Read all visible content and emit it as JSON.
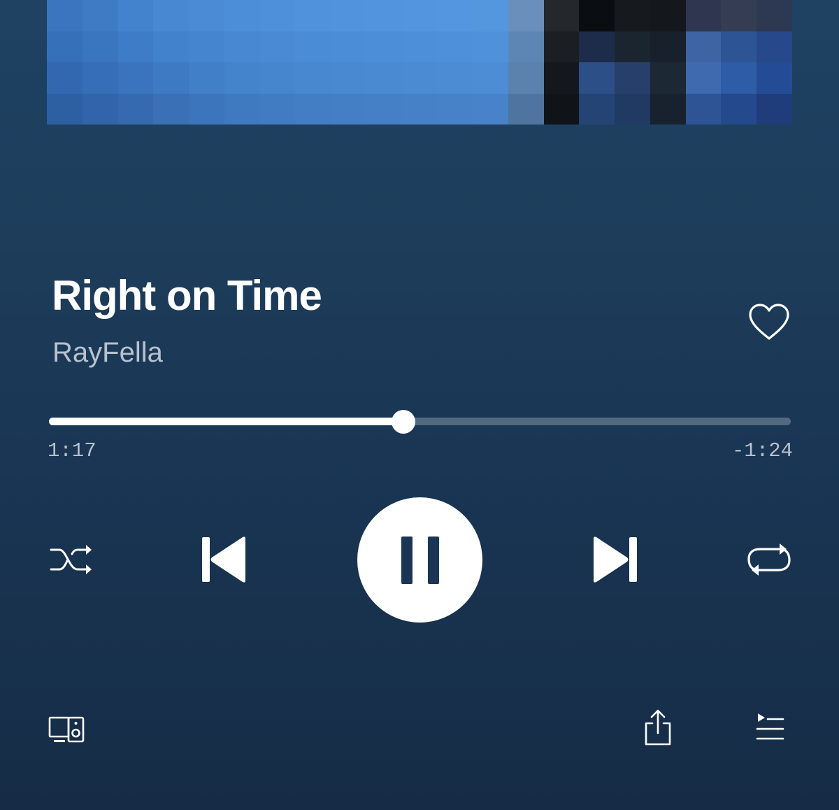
{
  "track": {
    "title": "Right on Time",
    "artist": "RayFella",
    "liked": false
  },
  "playback": {
    "elapsed": "1:17",
    "remaining": "-1:24",
    "progress_fraction": 0.478,
    "state": "playing"
  },
  "icons": {
    "like": "heart-outline-icon",
    "shuffle": "shuffle-icon",
    "previous": "skip-previous-icon",
    "pause": "pause-icon",
    "next": "skip-next-icon",
    "repeat": "repeat-icon",
    "devices": "connect-devices-icon",
    "share": "share-icon",
    "queue": "queue-icon"
  },
  "colors": {
    "background_top": "#1f4263",
    "background_bottom": "#162c46",
    "text_primary": "#ffffff",
    "text_secondary": "#b7c2cd",
    "progress_remaining": "rgba(255,255,255,0.25)"
  },
  "album_art": {
    "pixels": [
      [
        "#3b75bf",
        "#3f7bc5",
        "#4382cc",
        "#4888d2",
        "#4b8bd5",
        "#4d8ed8",
        "#4f90da",
        "#5092db",
        "#5193dc",
        "#5294dd",
        "#5395de",
        "#5496df",
        "#5597df",
        "#6a8fba",
        "#24272b",
        "#0a0d12",
        "#16191d",
        "#14181c",
        "#2f3650",
        "#353d55",
        "#2d3952"
      ],
      [
        "#3670b9",
        "#3a76c0",
        "#3e7cc7",
        "#4282cd",
        "#4585d0",
        "#4888d3",
        "#4a8ad5",
        "#4b8cd6",
        "#4c8dd7",
        "#4d8ed8",
        "#4e8fd9",
        "#4f90da",
        "#5091db",
        "#5e86b4",
        "#1b1f24",
        "#1d2c4a",
        "#1a2530",
        "#18212b",
        "#3e64a3",
        "#2d5596",
        "#27488a"
      ],
      [
        "#3268b0",
        "#366eb7",
        "#3a74be",
        "#3e7ac4",
        "#4180c9",
        "#4484cc",
        "#4686ce",
        "#4888d0",
        "#4989d1",
        "#4a8ad2",
        "#4b8bd3",
        "#4c8cd4",
        "#4d8dd5",
        "#5a82ad",
        "#14171b",
        "#2c4f87",
        "#263f6b",
        "#1c2833",
        "#3f6ab0",
        "#2f5ca6",
        "#244c96"
      ],
      [
        "#2d5fa3",
        "#3164aa",
        "#356ab0",
        "#3970b6",
        "#3c75bb",
        "#3f79bf",
        "#417bc1",
        "#437dc3",
        "#447ec4",
        "#457fc5",
        "#4680c6",
        "#4781c7",
        "#4882c8",
        "#5074a0",
        "#101317",
        "#234475",
        "#203a63",
        "#17222e",
        "#2f5495",
        "#24498c",
        "#1e3d7a"
      ]
    ]
  }
}
